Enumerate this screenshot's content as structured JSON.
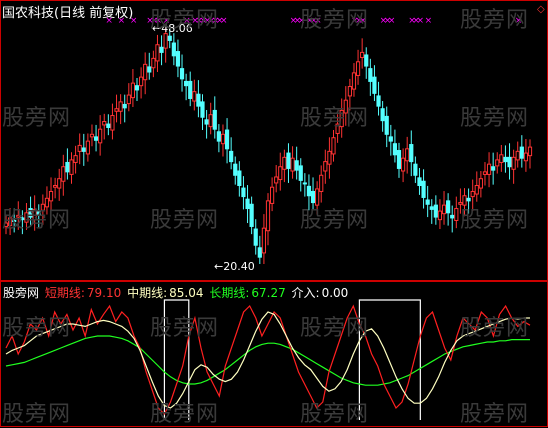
{
  "header": {
    "title": "国农科技(日线 前复权)"
  },
  "price_annotations": {
    "high": "48.06",
    "low": "20.40"
  },
  "indicator": {
    "name": "股旁网",
    "short_label": "短期线:",
    "short_value": "79.10",
    "mid_label": "中期线:",
    "mid_value": "85.04",
    "long_label": "长期线:",
    "long_value": "67.27",
    "entry_label": "介入:",
    "entry_value": "0.00"
  },
  "watermark": "股旁网",
  "colors": {
    "background": "#000000",
    "frame": "#cc0000",
    "up_candle": "#ff3333",
    "down_candle": "#54ffff",
    "marker": "#ff00ff",
    "short_line": "#ff2020",
    "mid_line": "#ffffc0",
    "long_line": "#20ff20",
    "entry_line": "#ffffff"
  },
  "chart_data": [
    {
      "type": "candlestick",
      "max_price": 48.06,
      "min_price": 20.4,
      "close_series": [
        25.2,
        25.8,
        25.4,
        26.1,
        25.6,
        26.4,
        25.9,
        26.8,
        26.2,
        27.4,
        28.1,
        28.9,
        29.6,
        30.4,
        31.8,
        31.2,
        32.6,
        33.1,
        34.3,
        33.6,
        34.8,
        35.6,
        34.9,
        36.2,
        37.1,
        36.4,
        37.8,
        38.6,
        39.4,
        38.7,
        40.2,
        41.6,
        40.8,
        42.3,
        43.8,
        42.9,
        44.5,
        46.1,
        45.2,
        47.4,
        46.6,
        44.8,
        43.6,
        42.1,
        41.3,
        39.8,
        40.6,
        38.9,
        37.6,
        36.8,
        37.9,
        36.2,
        34.8,
        35.6,
        33.9,
        32.4,
        30.8,
        29.6,
        28.3,
        26.9,
        24.8,
        22.6,
        21.2,
        24.6,
        27.8,
        29.4,
        30.6,
        31.8,
        32.9,
        31.6,
        32.8,
        31.4,
        30.2,
        29.8,
        28.4,
        27.6,
        29.2,
        30.8,
        32.4,
        33.6,
        35.2,
        36.8,
        38.4,
        39.6,
        41.2,
        42.8,
        44.1,
        45.2,
        43.6,
        41.8,
        40.4,
        38.9,
        37.2,
        35.6,
        34.8,
        33.2,
        31.6,
        32.8,
        33.9,
        32.4,
        30.8,
        29.6,
        28.2,
        27.4,
        26.8,
        25.9,
        26.6,
        27.3,
        26.4,
        25.8,
        26.9,
        27.6,
        28.4,
        27.8,
        28.9,
        29.6,
        30.4,
        31.2,
        32.1,
        31.4,
        32.6,
        33.2,
        32.4,
        31.8,
        32.9,
        33.6,
        32.8,
        33.4,
        34.1
      ]
    },
    {
      "type": "line",
      "series": [
        {
          "name": "短期线",
          "last": 79.1
        },
        {
          "name": "中期线",
          "last": 85.04
        },
        {
          "name": "长期线",
          "last": 67.27
        },
        {
          "name": "介入",
          "last": 0.0
        }
      ],
      "short": [
        60,
        70,
        55,
        65,
        80,
        75,
        85,
        70,
        90,
        80,
        88,
        75,
        85,
        70,
        92,
        80,
        88,
        95,
        82,
        90,
        85,
        70,
        60,
        40,
        25,
        10,
        5,
        15,
        30,
        45,
        70,
        85,
        60,
        40,
        30,
        20,
        45,
        60,
        75,
        90,
        95,
        85,
        70,
        80,
        90,
        85,
        70,
        55,
        40,
        30,
        20,
        10,
        15,
        40,
        55,
        70,
        85,
        95,
        80,
        70,
        55,
        45,
        30,
        20,
        10,
        15,
        30,
        50,
        70,
        85,
        90,
        75,
        60,
        50,
        70,
        85,
        80,
        75,
        90,
        85,
        70,
        88,
        95,
        85,
        78,
        82,
        79
      ],
      "mid": [
        55,
        58,
        60,
        62,
        66,
        70,
        72,
        74,
        76,
        78,
        80,
        80,
        79,
        78,
        80,
        82,
        83,
        82,
        80,
        78,
        74,
        68,
        58,
        45,
        32,
        20,
        12,
        10,
        14,
        22,
        32,
        42,
        46,
        44,
        38,
        34,
        32,
        34,
        40,
        50,
        62,
        74,
        84,
        90,
        88,
        80,
        70,
        60,
        52,
        46,
        42,
        35,
        28,
        24,
        26,
        32,
        42,
        55,
        66,
        74,
        76,
        70,
        60,
        48,
        36,
        26,
        18,
        14,
        14,
        18,
        26,
        36,
        48,
        58,
        66,
        70,
        72,
        74,
        76,
        78,
        80,
        82,
        84,
        85,
        84,
        85,
        85
      ],
      "long": [
        45,
        46,
        47,
        48,
        50,
        52,
        54,
        56,
        58,
        60,
        62,
        64,
        66,
        68,
        69,
        70,
        70,
        70,
        69,
        68,
        66,
        63,
        60,
        55,
        50,
        45,
        40,
        36,
        33,
        31,
        30,
        30,
        31,
        33,
        36,
        39,
        42,
        46,
        50,
        54,
        58,
        61,
        63,
        64,
        64,
        63,
        61,
        59,
        56,
        53,
        50,
        47,
        44,
        41,
        38,
        35,
        33,
        31,
        30,
        29,
        29,
        29,
        30,
        31,
        33,
        35,
        37,
        40,
        43,
        46,
        49,
        52,
        55,
        57,
        59,
        61,
        62,
        63,
        64,
        65,
        65,
        66,
        66,
        67,
        67,
        67,
        67
      ],
      "entry_blocks": [
        [
          26,
          30
        ],
        [
          58,
          68
        ]
      ]
    }
  ]
}
